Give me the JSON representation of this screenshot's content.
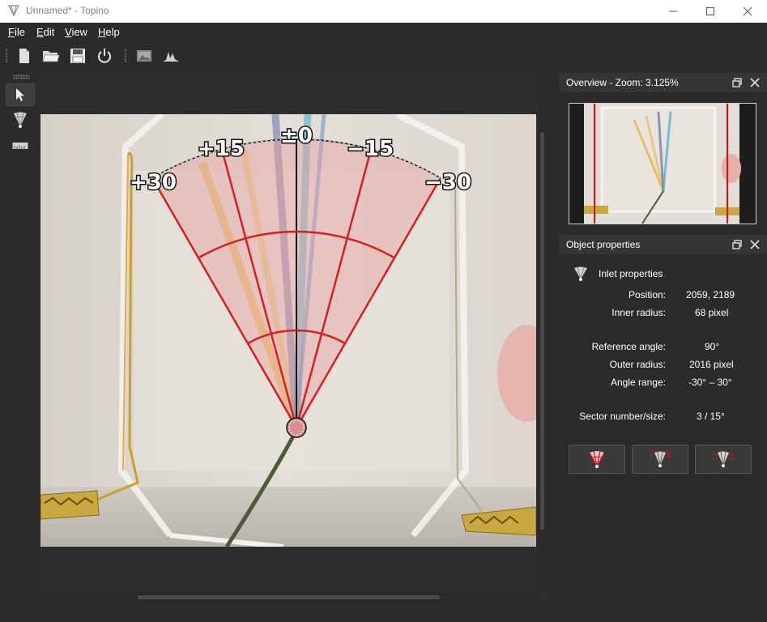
{
  "window": {
    "title": "Unnamed* - Topino"
  },
  "menu": [
    {
      "label": "File",
      "accel": "F",
      "rest": "ile"
    },
    {
      "label": "Edit",
      "accel": "E",
      "rest": "dit"
    },
    {
      "label": "View",
      "accel": "V",
      "rest": "iew"
    },
    {
      "label": "Help",
      "accel": "H",
      "rest": "elp"
    }
  ],
  "toolbar": {
    "icons": [
      "new-file-icon",
      "open-folder-icon",
      "save-icon",
      "power-icon",
      "image-select-icon",
      "histogram-icon"
    ]
  },
  "tools": {
    "icons": [
      "pointer-icon",
      "inlet-icon",
      "ruler-icon"
    ],
    "active": "pointer-icon"
  },
  "canvas": {
    "sector_labels": [
      "+30",
      "+15",
      "±0",
      "−15",
      "−30"
    ]
  },
  "overview": {
    "title": "Overview - Zoom: 3.125%"
  },
  "object_properties": {
    "title": "Object properties",
    "section_title": "Inlet properties",
    "position_label": "Position:",
    "position_value": "2059, 2189",
    "inner_radius_label": "Inner radius:",
    "inner_radius_value": "68 pixel",
    "reference_angle_label": "Reference angle:",
    "reference_angle_value": "90°",
    "outer_radius_label": "Outer radius:",
    "outer_radius_value": "2016 pixel",
    "angle_range_label": "Angle range:",
    "angle_range_value": "-30° – 30°",
    "sector_label": "Sector number/size:",
    "sector_value": "3 / 15°",
    "buttons": [
      "sector-red-icon",
      "sector-rotate-icon",
      "sector-spread-icon"
    ]
  },
  "colors": {
    "sector_fill": "#e8a0a0",
    "sector_line": "#d42020",
    "dark_bg": "#2b2b2b",
    "dock_header": "#353535"
  }
}
